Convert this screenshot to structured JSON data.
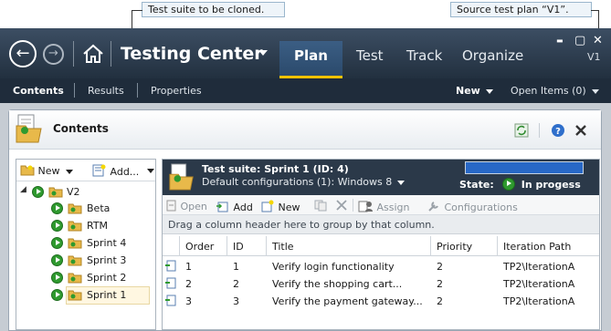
{
  "callouts": {
    "clone": "Test suite to be cloned.",
    "source": "Source test plan “V1”."
  },
  "app": {
    "title": "Testing Center",
    "version": "V1",
    "tabs": [
      "Plan",
      "Test",
      "Track",
      "Organize"
    ],
    "active_tab": "Plan",
    "window_controls": {
      "minimize": "▬",
      "restore": "▢",
      "close": "✕"
    }
  },
  "subnav": {
    "items": [
      "Contents",
      "Results",
      "Properties"
    ],
    "active": "Contents",
    "new_label": "New",
    "open_items_label": "Open Items (0)"
  },
  "panel": {
    "title": "Contents",
    "tree": {
      "new_label": "New",
      "add_label": "Add...",
      "root": {
        "name": "V2",
        "expanded": true
      },
      "children": [
        "Beta",
        "RTM",
        "Sprint 4",
        "Sprint 3",
        "Sprint 2",
        "Sprint 1"
      ],
      "selected": "Sprint 1"
    },
    "suite": {
      "name": "Test suite:  Sprint 1 (ID: 4)",
      "config": "Default configurations (1):  Windows 8",
      "progress_fraction": 1.0,
      "state_label": "State:",
      "state_value": "In progess"
    },
    "toolbar": {
      "open": "Open",
      "add": "Add",
      "new": "New",
      "assign": "Assign",
      "configurations": "Configurations"
    },
    "group_hint": "Drag a column header here to group by that column.",
    "columns": [
      "Order",
      "ID",
      "Title",
      "Priority",
      "Iteration Path"
    ],
    "rows": [
      {
        "order": "1",
        "id": "1",
        "title": "Verify login functionality",
        "priority": "2",
        "path": "TP2\\IterationA"
      },
      {
        "order": "2",
        "id": "2",
        "title": "Verify the shopping cart...",
        "priority": "2",
        "path": "TP2\\IterationA"
      },
      {
        "order": "3",
        "id": "3",
        "title": "Verify the payment gateway...",
        "priority": "2",
        "path": "TP2\\IterationA"
      }
    ]
  },
  "colors": {
    "title_bar": "#2d3d4f",
    "accent": "#f2c200",
    "active_tab": "#34567a",
    "run_green": "#2f9a2f"
  }
}
